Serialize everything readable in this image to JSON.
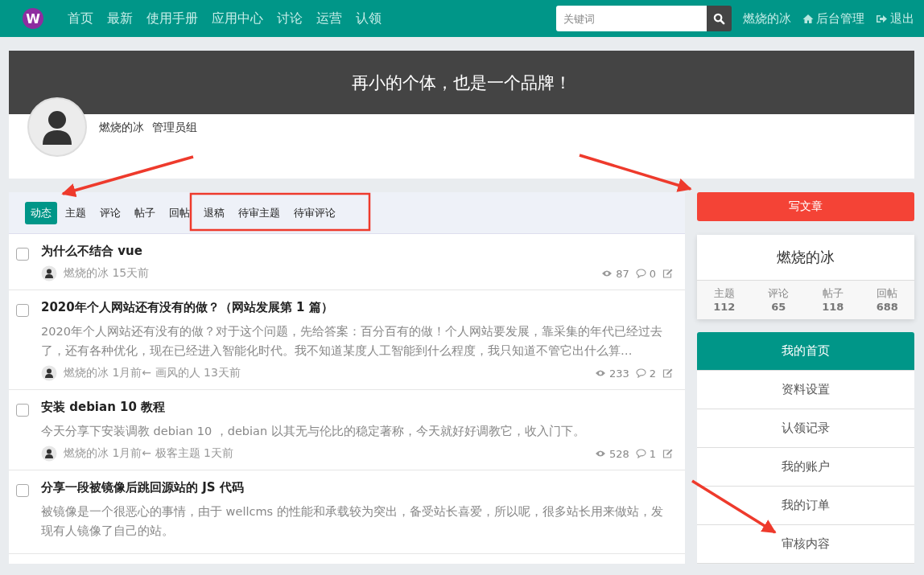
{
  "nav": {
    "logo": "W",
    "links": [
      {
        "label": "首页"
      },
      {
        "label": "最新"
      },
      {
        "label": "使用手册"
      },
      {
        "label": "应用中心"
      },
      {
        "label": "讨论"
      },
      {
        "label": "运营"
      },
      {
        "label": "认领"
      }
    ],
    "search": {
      "placeholder": "关键词"
    },
    "user": "燃烧的冰",
    "admin": "后台管理",
    "logout": "退出"
  },
  "banner": {
    "slogan": "再小的个体，也是一个品牌！",
    "username": "燃烧的冰",
    "group": "管理员组"
  },
  "tabs": [
    {
      "label": "动态",
      "selected": true
    },
    {
      "label": "主题",
      "selected": false
    },
    {
      "label": "评论",
      "selected": false
    },
    {
      "label": "帖子",
      "selected": false
    },
    {
      "label": "回帖",
      "selected": false
    },
    {
      "label": "退稿",
      "selected": false
    },
    {
      "label": "待审主题",
      "selected": false
    },
    {
      "label": "待审评论",
      "selected": false
    }
  ],
  "posts": [
    {
      "title": "为什么不结合 vue",
      "checked": false,
      "author": "燃烧的冰",
      "time": "15天前",
      "views": "87",
      "comments": "0"
    },
    {
      "title": "2020年个人网站还有没有的做？（网站发展第 1 篇）",
      "checked": false,
      "excerpt": "2020年个人网站还有没有的做？对于这个问题，先给答案：百分百有的做！个人网站要发展，靠采集的年代已经过去了，还有各种优化，现在已经进入智能化时代。我不知道某度人工智能到什么程度，我只知道不管它出什么算…",
      "author": "燃烧的冰",
      "time": "1月前",
      "separator": "←",
      "last_user": "画风的人",
      "last_time": "13天前",
      "views": "233",
      "comments": "2"
    },
    {
      "title": "安装 debian 10 教程",
      "checked": false,
      "excerpt": "今天分享下安装调教 debian 10 ，debian 以其无与伦比的稳定著称，今天就好好调教它，收入门下。",
      "author": "燃烧的冰",
      "time": "1月前",
      "separator": "←",
      "last_user": "极客主题",
      "last_time": "1天前",
      "views": "528",
      "comments": "1"
    },
    {
      "title": "分享一段被镜像后跳回源站的 JS 代码",
      "checked": false,
      "excerpt": "被镜像是一个很恶心的事情，由于 wellcms 的性能和承载较为突出，备受站长喜爱，所以呢，很多站长用来做站，发现有人镜像了自己的站。"
    }
  ],
  "sidebar": {
    "write_button": "写文章",
    "profile": {
      "name": "燃烧的冰",
      "stats": [
        {
          "label": "主题",
          "value": "112"
        },
        {
          "label": "评论",
          "value": "65"
        },
        {
          "label": "帖子",
          "value": "118"
        },
        {
          "label": "回帖",
          "value": "688"
        }
      ]
    },
    "menu": [
      {
        "label": "我的首页",
        "selected": true
      },
      {
        "label": "资料设置",
        "selected": false
      },
      {
        "label": "认领记录",
        "selected": false
      },
      {
        "label": "我的账户",
        "selected": false
      },
      {
        "label": "我的订单",
        "selected": false
      },
      {
        "label": "审核内容",
        "selected": false
      }
    ]
  }
}
